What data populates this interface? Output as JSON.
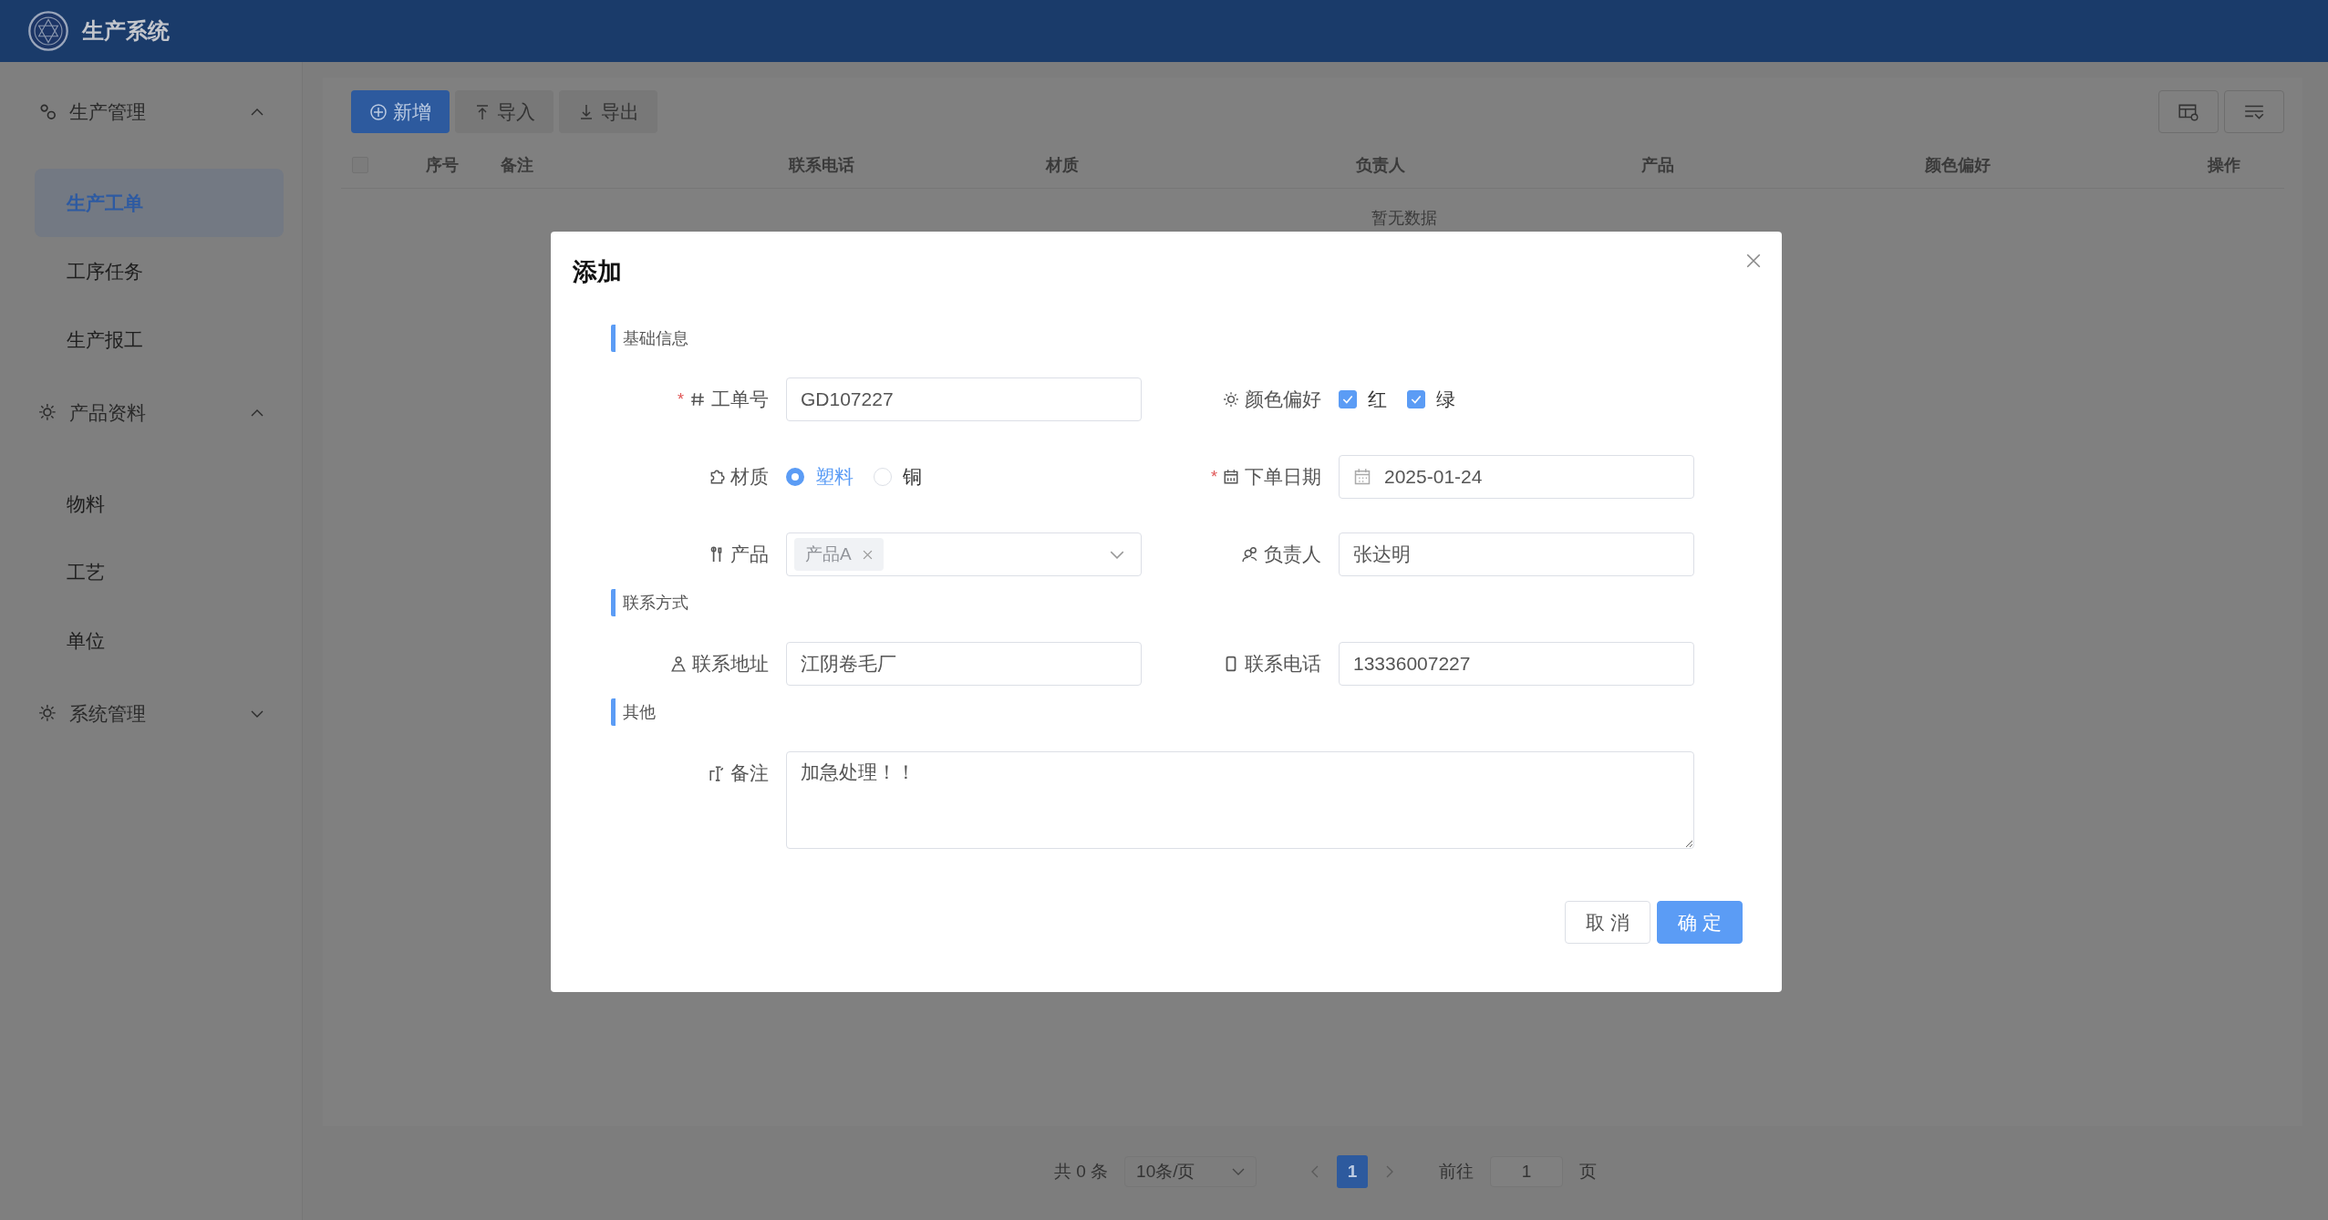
{
  "app": {
    "title": "生产系统"
  },
  "sidebar": {
    "groups": [
      {
        "label": "生产管理",
        "expanded": true,
        "items": [
          {
            "label": "生产工单",
            "selected": true
          },
          {
            "label": "工序任务",
            "selected": false
          },
          {
            "label": "生产报工",
            "selected": false
          }
        ]
      },
      {
        "label": "产品资料",
        "expanded": true,
        "items": [
          {
            "label": "物料",
            "selected": false
          },
          {
            "label": "工艺",
            "selected": false
          },
          {
            "label": "单位",
            "selected": false
          }
        ]
      },
      {
        "label": "系统管理",
        "expanded": false
      }
    ]
  },
  "toolbar": {
    "buttons": [
      {
        "label": "新增",
        "kind": "primary"
      },
      {
        "label": "导入",
        "kind": "plain"
      },
      {
        "label": "导出",
        "kind": "plain"
      }
    ]
  },
  "table": {
    "select_all": {
      "checked": false
    },
    "columns": [
      "序号",
      "备注",
      "联系电话",
      "材质",
      "负责人",
      "产品",
      "颜色偏好",
      "操作"
    ],
    "empty_text": "暂无数据"
  },
  "pagination": {
    "total": "共 0 条",
    "page_size": "10条/页",
    "pages": [
      {
        "label": "1",
        "selected": true
      }
    ],
    "goto_label": "前往",
    "goto_value": "1",
    "page_unit": "页"
  },
  "dialog": {
    "title": "添加",
    "sections": [
      {
        "title": "基础信息",
        "fields": [
          {
            "label": "工单号",
            "required_mark": "*",
            "kind": "text",
            "value": "GD107227"
          },
          {
            "label": "颜色偏好",
            "kind": "checkbox",
            "options": [
              {
                "label": "红",
                "checked": true
              },
              {
                "label": "绿",
                "checked": true
              }
            ]
          },
          {
            "label": "材质",
            "kind": "radio",
            "options": [
              {
                "label": "塑料",
                "selected": true
              },
              {
                "label": "铜",
                "selected": false
              }
            ]
          },
          {
            "label": "下单日期",
            "required_mark": "*",
            "kind": "date",
            "value": "2025-01-24"
          },
          {
            "label": "产品",
            "kind": "select",
            "tags": [
              "产品A"
            ]
          },
          {
            "label": "负责人",
            "kind": "text",
            "value": "张达明"
          }
        ]
      },
      {
        "title": "联系方式",
        "fields": [
          {
            "label": "联系地址",
            "kind": "text",
            "value": "江阴卷毛厂"
          },
          {
            "label": "联系电话",
            "kind": "text",
            "value": "13336007227"
          }
        ]
      },
      {
        "title": "其他",
        "fields": [
          {
            "label": "备注",
            "kind": "textarea",
            "value": "加急处理！！"
          }
        ]
      }
    ],
    "buttons": [
      {
        "label": "取 消",
        "kind": "plain"
      },
      {
        "label": "确 定",
        "kind": "primary"
      }
    ]
  }
}
